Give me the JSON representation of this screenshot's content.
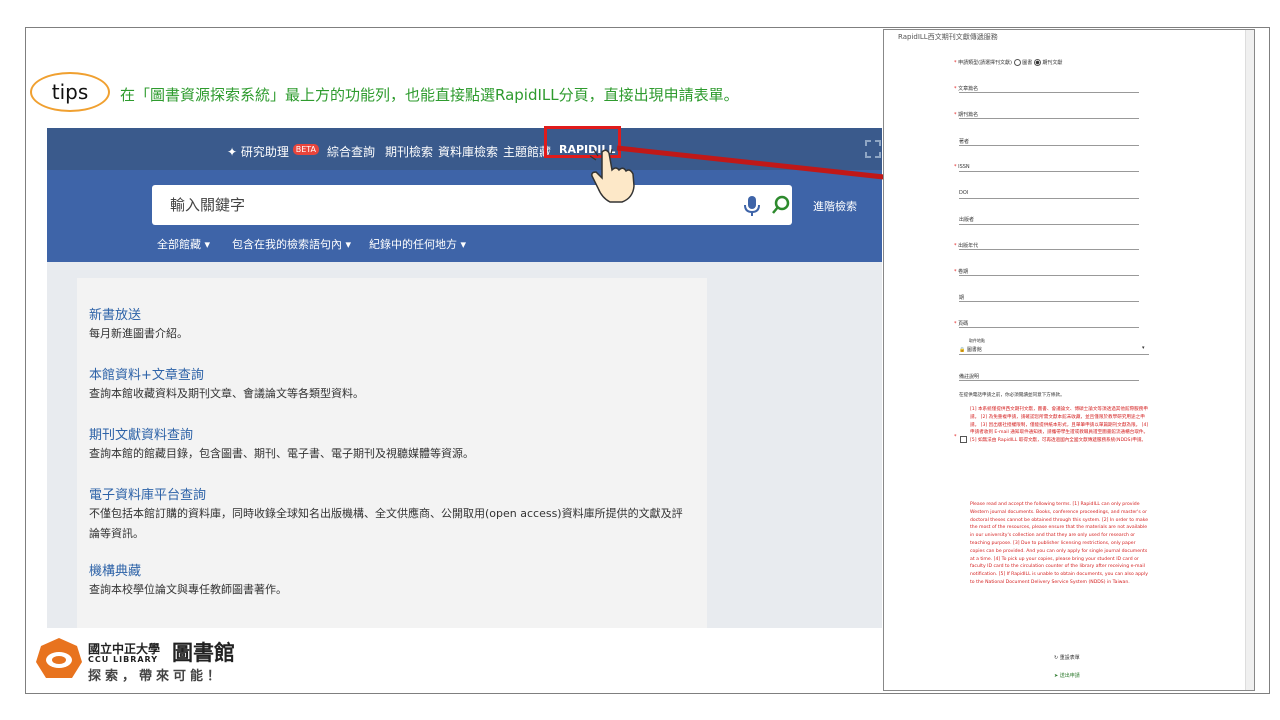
{
  "tip": {
    "badge": "tips",
    "text": "在「圖書資源探索系統」最上方的功能列，也能直接點選RapidILL分頁，直接出現申請表單。"
  },
  "nav": {
    "research_assistant": "研究助理",
    "beta": "BETA",
    "items": [
      "綜合查詢",
      "期刊檢索",
      "資料庫檢索",
      "主題館藏",
      "RAPIDILL"
    ],
    "more": "..."
  },
  "search": {
    "placeholder": "輸入關鍵字",
    "advanced": "進階檢索",
    "filters": [
      "全部館藏 ▾",
      "包含在我的檢索語句內 ▾",
      "紀錄中的任何地方 ▾"
    ]
  },
  "sections": [
    {
      "title": "新書放送",
      "desc": "每月新進圖書介紹。"
    },
    {
      "title": "本館資料+文章查詢",
      "desc": "查詢本館收藏資料及期刊文章、會議論文等各類型資料。"
    },
    {
      "title": "期刊文獻資料查詢",
      "desc": "查詢本館的館藏目錄，包含圖書、期刊、電子書、電子期刊及視聽媒體等資源。"
    },
    {
      "title": "電子資料庫平台查詢",
      "desc": "不僅包括本館訂購的資料庫，同時收錄全球知名出版機構、全文供應商、公開取用(open access)資料庫所提供的文獻及評論等資訊。"
    },
    {
      "title": "機構典藏",
      "desc": "查詢本校學位論文與專任教師圖書著作。"
    }
  ],
  "logo": {
    "name": "國立中正大學",
    "big": "圖書館",
    "sub": "CCU LIBRARY",
    "slogan": "探索，帶來可能！"
  },
  "form": {
    "title": "RapidILL西文期刊文獻傳遞服務",
    "type_label": "申請類型(請選擇刊文獻)",
    "type_options": [
      "圖書",
      "期刊文獻"
    ],
    "fields": [
      {
        "label": "文章篇名",
        "required": true
      },
      {
        "label": "期刊篇名",
        "required": true
      },
      {
        "label": "著者",
        "required": false
      },
      {
        "label": "ISSN",
        "required": true
      },
      {
        "label": "DOI",
        "required": false
      },
      {
        "label": "出版者",
        "required": false
      },
      {
        "label": "出版年代",
        "required": true
      },
      {
        "label": "卷期",
        "required": true
      },
      {
        "label": "期",
        "required": false
      },
      {
        "label": "頁碼",
        "required": true
      }
    ],
    "pickup_label": "取件地點",
    "pickup_value": "圖書館",
    "note_label": "備註說明",
    "consent_intro": "在提供電話申請之前，你必須閱讀並同意下方條款。",
    "terms_zh": "[1] 本系統僅提供西文期刊文獻，圖書、會議論文、博碩士論文等須透過其他館際服務申請。 [2] 為免重複申請，請確認您所需文獻本館未收藏，並且僅限於教學研究用途之申請。 [3] 因出版社授權限制，僅能提供紙本形式，且單筆申請以單篇期刊文獻為限。 [4] 申請者收到 E-mail 通知取件通知後，請攜帶學生證或教職員證至圖書館流通櫃台取件。 [5] 如無法由 RapidILL 取得文獻，可再透過國內全國文獻傳遞服務系統(NDDS)申請。",
    "terms_en": "Please read and accept the following terms. [1] RapidILL can only provide Western journal documents. Books, conference proceedings, and master's or doctoral theses cannot be obtained through this system. [2] In order to make the most of the resources, please ensure that the materials are not available in our university's collection and that they are only used for research or teaching purpose. [3] Due to publisher licensing restrictions, only paper copies can be provided. And you can only apply for single journal documents at a time. [4] To pick up your copies, please bring your student ID card or faculty ID card to the circulation counter of the library after receiving e-mail notification. [5] If RapidILL is unable to obtain documents, you can also apply to the National Document Delivery Service System (NDDS) in Taiwan.",
    "reset": "重設表單",
    "submit": "送出申請"
  },
  "colors": {
    "nav_bg": "#3a5a8c",
    "hero_bg": "#3e64a8",
    "tip_text": "#2e9b2e",
    "highlight": "#e01b1b",
    "link_blue": "#2e63a8"
  }
}
